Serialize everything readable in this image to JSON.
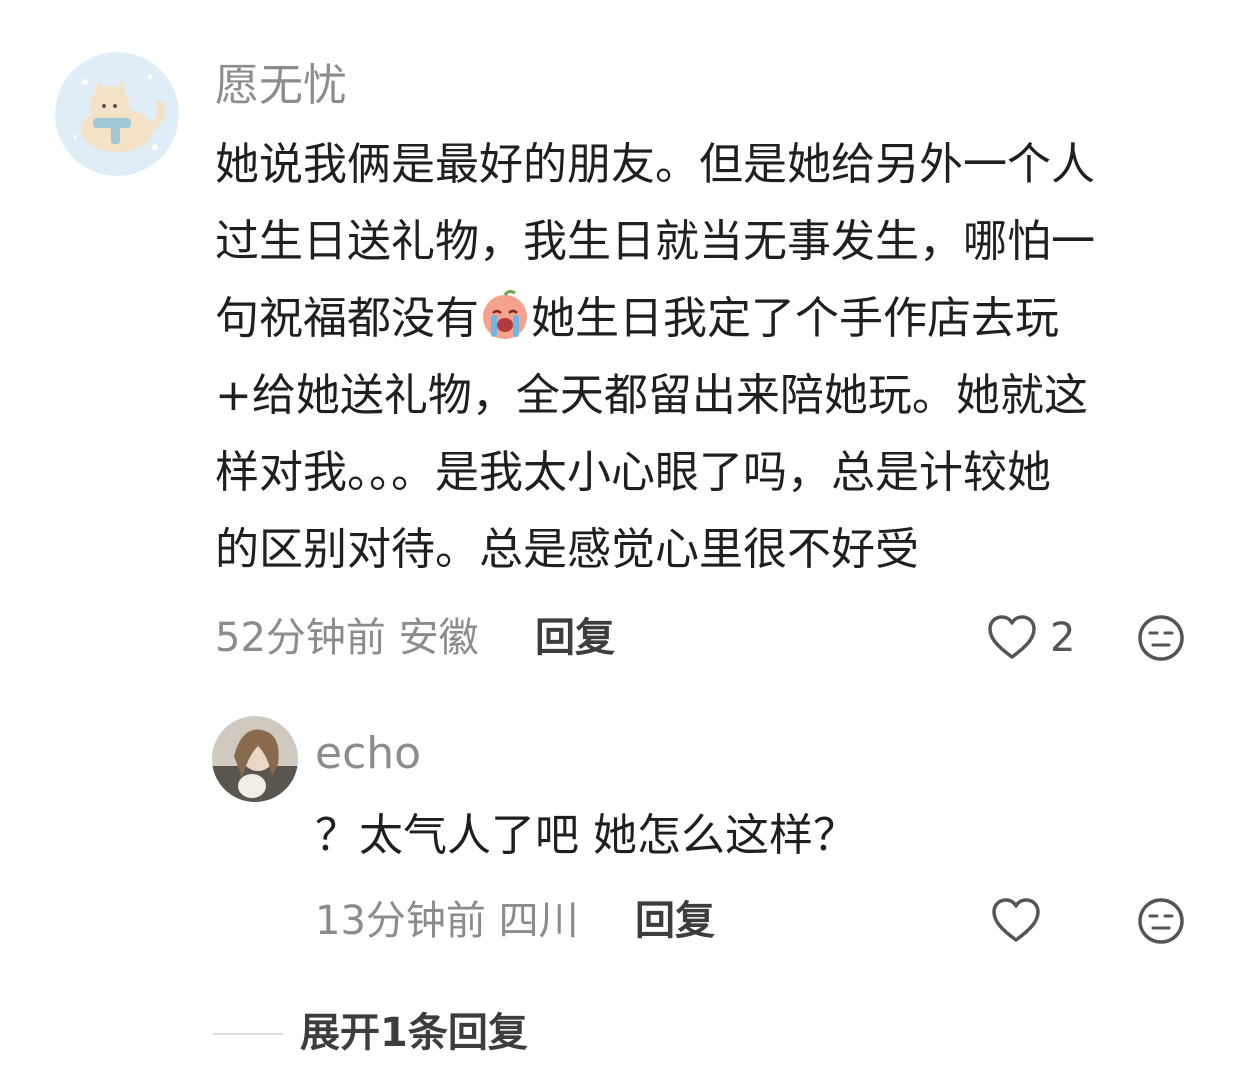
{
  "comment": {
    "username": "愿无忧",
    "lines": [
      "她说我俩是最好的朋友。但是她给另外一个人",
      "过生日送礼物，我生日就当无事发生，哪怕一",
      "句祝福都没有",
      "她生日我定了个手作店去玩",
      "+给她送礼物，全天都留出来陪她玩。她就这",
      "样对我。。。是我太小心眼了吗，总是计较她",
      "的区别对待。总是感觉心里很不好受"
    ],
    "time": "52分钟前",
    "location": "安徽",
    "reply_label": "回复",
    "like_count": "2"
  },
  "reply": {
    "username": "echo",
    "text": "？太气人了吧 她怎么这样？",
    "time": "13分钟前",
    "location": "四川",
    "reply_label": "回复"
  },
  "expand_label": "展开1条回复",
  "icons": {
    "like": "heart-outline-icon",
    "dislike": "neutral-face-icon",
    "emoji": "crying-face-emoji"
  }
}
